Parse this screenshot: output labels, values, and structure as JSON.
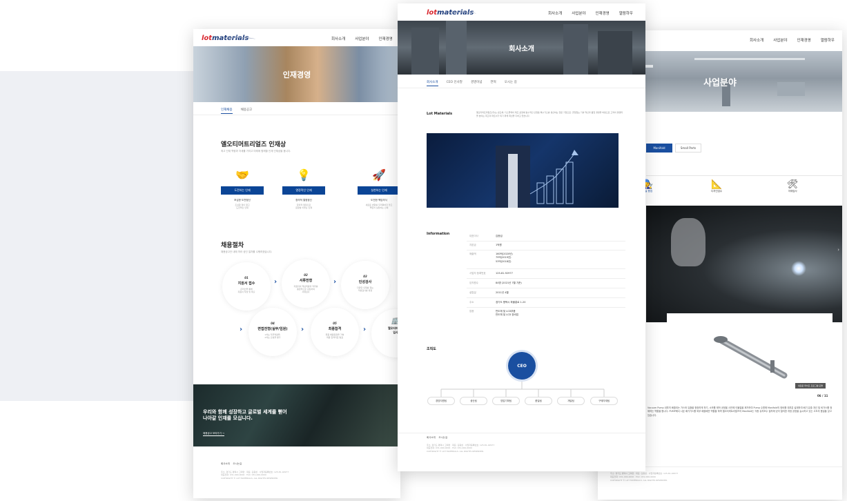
{
  "logo": {
    "lead": "lot",
    "rest": "materials"
  },
  "nav_left": [
    "회사소개",
    "사업분야",
    "인재경영"
  ],
  "nav_center": [
    "회사소개",
    "사업분야",
    "인재경영",
    "열람하우"
  ],
  "nav_right": [
    "회사소개",
    "사업분야",
    "인재경영",
    "열람하우"
  ],
  "left_page": {
    "hero_title": "인재경영",
    "tabs": [
      "인재채용",
      "채용공고"
    ],
    "talent_title": "엘오티머트리얼즈 인재상",
    "talent_sub": "최고 인재 역량과 자세를 가지고 미래에 함께할 인재 인재상을 봅니다.",
    "values": [
      {
        "icon": "handshake-icon",
        "glyph": "🤝",
        "btn": "도전하는 인재",
        "s1": "조심한 도전정신",
        "s2": "조심함 정이 알고\n도전적인 인재"
      },
      {
        "icon": "lightbulb-icon",
        "glyph": "💡",
        "btn": "열정적인 인재",
        "s1": "창의적 열정정신",
        "s2": "창의적 열정으로\n글로벌 이루는 인재"
      },
      {
        "icon": "rocket-icon",
        "glyph": "🚀",
        "btn": "실천하는 인재",
        "s1": "도전한 책임의식",
        "s2": "새로운 변화를 두려워하지 않고\n책임적 실천하는 인재"
      }
    ],
    "process_title": "채용절차",
    "process_sub": "채용공고안 내에 따라 공인 절차를 수행하겠습니다.",
    "steps": [
      {
        "n": "01",
        "t": "지원서 접수",
        "d": "온라인을 통해\n지원서 작성 및 제출"
      },
      {
        "n": "02",
        "t": "서류전형",
        "d": "지원자의 핵심역량과 직무를\n종합적으로 검토하여\n서류심사"
      },
      {
        "n": "03",
        "t": "인성검사",
        "d": "다양한 인재를 찾는\n적성검사를 측정"
      },
      {
        "n": "04",
        "t": "면접전형(실무/임원)",
        "d": "1차는 직무역량을,\n2차는 인성을 평가"
      },
      {
        "n": "05",
        "t": "최종합격",
        "d": "최종 채용일정을 거쳐\n최종 합격자로 발표"
      },
      {
        "n": "",
        "t": "엘오티머트리\n입사",
        "d": ""
      }
    ],
    "banner_h1": "우리와 함께 성장하고 글로벌 세계를 뻗어",
    "banner_h2": "나아갈 인재를 모십니다.",
    "banner_link": "채용공고 보러가기 →",
    "footer_links": [
      "회사소개",
      "오시는길"
    ],
    "footer_info": "주소: 경기도 평택시 고덕면 · 대표: 김종섭 · 사업자등록번호: 125-81-92977\n대표전화: 031-000-0000 · FAX: 031-000-0000\nCOPYRIGHT © LOT MATERIALS. ALL RIGHTS RESERVED."
  },
  "center_page": {
    "hero_title": "회사소개",
    "tabs": [
      "회사소개",
      "CEO 인사말",
      "경영이념",
      "연혁",
      "오시는 길"
    ],
    "lot_label": "Lot Materials",
    "lot_text": "엘오티머트리얼즈(주)는 반도체, 디스플레이 제조 공정에 필수적인 산업용 특수가스를 생산하는 전문 기업으로, 끊임없는 기술 혁신과 품질 경영을 바탕으로 고객의 경쟁력을 높이는 최고의 파트너가 되기 위해 최선을 다하고 있습니다.",
    "info_label": "Information",
    "info": [
      {
        "k": "대표이사",
        "v": "김종섭"
      },
      {
        "k": "자본금",
        "v": "1억원"
      },
      {
        "k": "매출액",
        "v": "160억(2020년)\n79억(2019년)\n53억(2018년)"
      },
      {
        "k": "사업자 등록번호",
        "v": "125-81-92977"
      },
      {
        "k": "임직원수",
        "v": "84명 (2021년 7월 기준)"
      },
      {
        "k": "설립일",
        "v": "2011년 4월"
      },
      {
        "k": "주소",
        "v": "경기도 평택시 파볼릉로 1-20"
      },
      {
        "k": "업종",
        "v": "반도체 및 LCD부품\n반도체 및 LCD 장비업"
      }
    ],
    "org_label": "조직도",
    "ceo": "CEO",
    "depts": [
      "경영지원팀",
      "생산팀",
      "영업기획팀",
      "품질팀",
      "개발팀",
      "구매자재팀"
    ],
    "footer_links": [
      "회사소개",
      "오시는길"
    ],
    "footer_info": "주소: 경기도 평택시 고덕면 · 대표: 김종섭 · 사업자등록번호: 125-81-92977\n대표전화: 031-000-0000 · FAX: 031-000-0000\nCOPYRIGHT © LOT MATERIALS. ALL RIGHTS RESERVED."
  },
  "right_page": {
    "hero_title": "사업분야",
    "tabs": [
      "Manifold",
      "Small Parts"
    ],
    "cats": [
      {
        "icon": "worker-icon",
        "glyph": "🧑‍🔧",
        "label": "기술 용접"
      },
      {
        "icon": "design-icon",
        "glyph": "📐",
        "label": "디자인검수"
      },
      {
        "icon": "tools-icon",
        "glyph": "🛠",
        "label": "자재검사"
      }
    ],
    "pipe_caption": "새로운 파이프 프로그램 모듈",
    "counter": "06 / 11",
    "description": "Vacuum Pump 내부의 배출되는 가스와 유출을 청정하게 하기, 소모를 제작 공정을 사전에 이물질을 제거하여 Pump 수명에 Manifold의 정비를 대부분 설계하여 배기 유출 개선 및 비가스를 정제하는 역할을 합니다. PUMP에서 나온 배기가스를 외부 배출배관 역할을 하며 엘오티머트리얼즈의 Manifold는 각종 유지보수 절차에 있어 철저한 개정 공정을 실시하고 있는 고도의 품질을 갖고 있습니다.",
    "footer_info": "주소: 경기도 평택시 고덕면 · 대표: 김종섭 · 사업자등록번호: 125-81-92977\n대표전화: 031-000-0000 · FAX: 031-000-0000\nCOPYRIGHT © LOT MATERIALS. ALL RIGHTS RESERVED."
  },
  "colors": {
    "brand_blue": "#1a4fa0",
    "dark_blue": "#0b4596",
    "logo_red": "#d8262e"
  }
}
